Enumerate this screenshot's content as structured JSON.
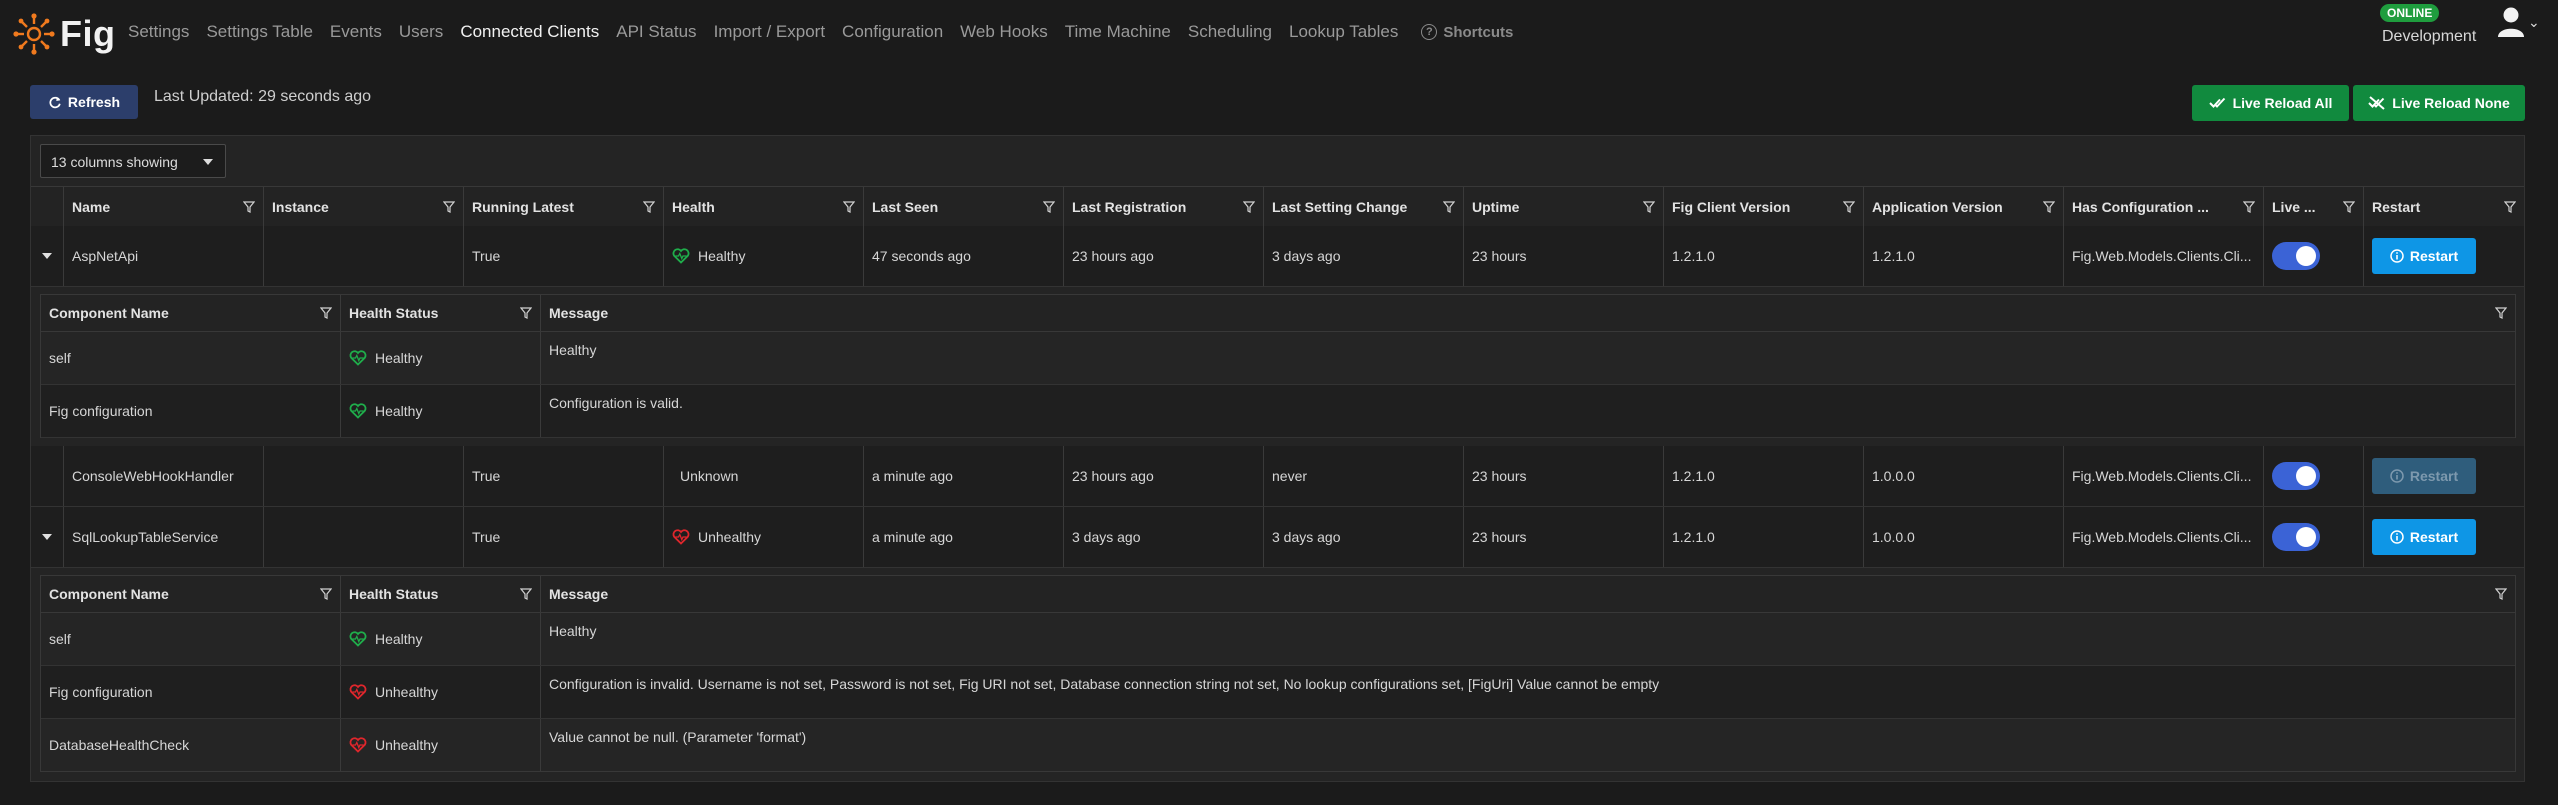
{
  "app": {
    "name": "Fig"
  },
  "nav": {
    "items": [
      "Settings",
      "Settings Table",
      "Events",
      "Users",
      "Connected Clients",
      "API Status",
      "Import / Export",
      "Configuration",
      "Web Hooks",
      "Time Machine",
      "Scheduling",
      "Lookup Tables"
    ],
    "active": "Connected Clients",
    "shortcuts_label": "Shortcuts"
  },
  "status": {
    "badge": "ONLINE",
    "environment": "Development"
  },
  "toolbar": {
    "refresh_label": "Refresh",
    "last_updated": "Last Updated: 29 seconds ago",
    "live_reload_all": "Live Reload All",
    "live_reload_none": "Live Reload None"
  },
  "grid": {
    "columns_showing": "13 columns showing",
    "headers": [
      "Name",
      "Instance",
      "Running Latest",
      "Health",
      "Last Seen",
      "Last Registration",
      "Last Setting Change",
      "Uptime",
      "Fig Client Version",
      "Application Version",
      "Has Configuration ...",
      "Live ...",
      "Restart"
    ],
    "restart_label": "Restart",
    "rows": [
      {
        "name": "AspNetApi",
        "instance": "",
        "running_latest": "True",
        "health": "Healthy",
        "health_icon": "heart-healthy-icon",
        "last_seen": "47 seconds ago",
        "last_registration": "23 hours ago",
        "last_setting_change": "3 days ago",
        "uptime": "23 hours",
        "fig_client_version": "1.2.1.0",
        "application_version": "1.2.1.0",
        "has_configuration": "Fig.Web.Models.Clients.Cli...",
        "live_reload": true,
        "restart_enabled": true,
        "expanded": true,
        "details": {
          "headers": [
            "Component Name",
            "Health Status",
            "Message"
          ],
          "rows": [
            {
              "component": "self",
              "status": "Healthy",
              "message": "Healthy"
            },
            {
              "component": "Fig configuration",
              "status": "Healthy",
              "message": "Configuration is valid."
            }
          ]
        }
      },
      {
        "name": "ConsoleWebHookHandler",
        "instance": "",
        "running_latest": "True",
        "health": "Unknown",
        "health_icon": "",
        "last_seen": "a minute ago",
        "last_registration": "23 hours ago",
        "last_setting_change": "never",
        "uptime": "23 hours",
        "fig_client_version": "1.2.1.0",
        "application_version": "1.0.0.0",
        "has_configuration": "Fig.Web.Models.Clients.Cli...",
        "live_reload": true,
        "restart_enabled": false,
        "expanded": false
      },
      {
        "name": "SqlLookupTableService",
        "instance": "",
        "running_latest": "True",
        "health": "Unhealthy",
        "health_icon": "heart-unhealthy-icon",
        "last_seen": "a minute ago",
        "last_registration": "3 days ago",
        "last_setting_change": "3 days ago",
        "uptime": "23 hours",
        "fig_client_version": "1.2.1.0",
        "application_version": "1.0.0.0",
        "has_configuration": "Fig.Web.Models.Clients.Cli...",
        "live_reload": true,
        "restart_enabled": true,
        "expanded": true,
        "details": {
          "headers": [
            "Component Name",
            "Health Status",
            "Message"
          ],
          "rows": [
            {
              "component": "self",
              "status": "Healthy",
              "message": "Healthy"
            },
            {
              "component": "Fig configuration",
              "status": "Unhealthy",
              "message": "Configuration is invalid. Username is not set, Password is not set, Fig URI not set, Database connection string not set, No lookup configurations set, [FigUri] Value cannot be empty"
            },
            {
              "component": "DatabaseHealthCheck",
              "status": "Unhealthy",
              "message": "Value cannot be null. (Parameter 'format')"
            }
          ]
        }
      }
    ]
  },
  "colors": {
    "healthy": "#1fae4b",
    "unhealthy": "#e0262c",
    "accent": "#0e96e6",
    "toggle": "#3b63d6",
    "live_reload": "#118a3e",
    "online": "#1f9d3e",
    "logo": "#f07a1e"
  }
}
